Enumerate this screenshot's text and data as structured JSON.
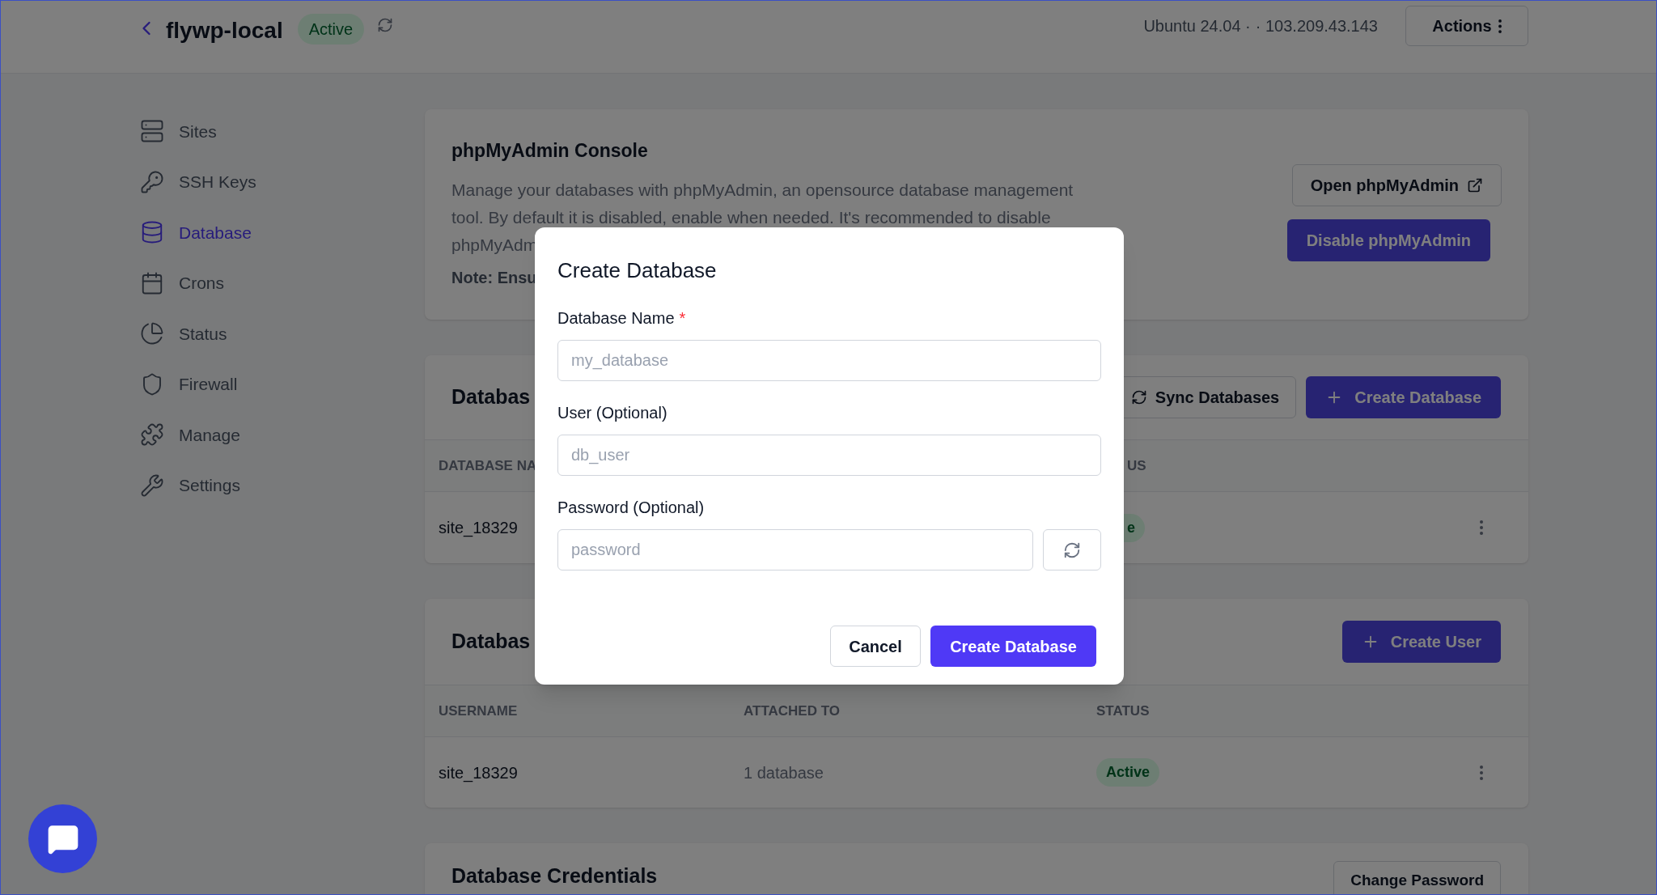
{
  "header": {
    "title": "flywp-local",
    "status": "Active",
    "server_os": "Ubuntu 24.04 ·",
    "server_ip": "· 103.209.43.143",
    "actions_button": "Actions"
  },
  "sidebar": {
    "items": [
      {
        "label": "Sites",
        "selected": false
      },
      {
        "label": "SSH Keys",
        "selected": false
      },
      {
        "label": "Database",
        "selected": true
      },
      {
        "label": "Crons",
        "selected": false
      },
      {
        "label": "Status",
        "selected": false
      },
      {
        "label": "Firewall",
        "selected": false
      },
      {
        "label": "Manage",
        "selected": false
      },
      {
        "label": "Settings",
        "selected": false
      }
    ]
  },
  "console_card": {
    "title": "phpMyAdmin Console",
    "description_lines": [
      "Manage your databases with phpMyAdmin, an opensource database management",
      "tool. By default it is disabled, enable when needed. It's recommended to disable",
      "phpMyAdm"
    ],
    "note": "Note: Ensu",
    "open_button": "Open phpMyAdmin",
    "disable_button": "Disable phpMyAdmin"
  },
  "databases_card": {
    "title": "Databas",
    "sync_button": "Sync Databases",
    "create_button": "Create Database",
    "columns": [
      "DATABASE NA",
      "US"
    ],
    "rows": [
      {
        "name": "site_18329",
        "status": "e"
      }
    ]
  },
  "users_card": {
    "title": "Databas",
    "create_button": "Create User",
    "columns": [
      "USERNAME",
      "ATTACHED TO",
      "STATUS"
    ],
    "rows": [
      {
        "username": "site_18329",
        "attached_to": "1 database",
        "status": "Active"
      }
    ]
  },
  "credentials_card": {
    "title": "Database Credentials",
    "button": "Change Password"
  },
  "modal": {
    "title": "Create Database",
    "fields": [
      {
        "kind": "text",
        "label": "Database Name",
        "required_mark": "*",
        "placeholder": "my_database"
      },
      {
        "kind": "text",
        "label": "User (Optional)",
        "placeholder": "db_user"
      },
      {
        "kind": "password",
        "label": "Password (Optional)",
        "placeholder": "password"
      }
    ],
    "cancel_button": "Cancel",
    "submit_button": "Create Database"
  }
}
